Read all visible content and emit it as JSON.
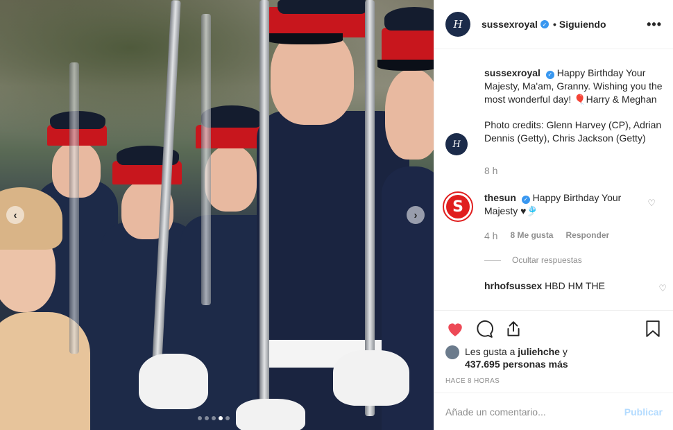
{
  "post": {
    "photo": {
      "carousel_dots": 5,
      "active_dot": 3
    },
    "header": {
      "avatar_monogram": "H",
      "username": "sussexroyal",
      "verified": true,
      "separator": "•",
      "follow_label": "Siguiendo",
      "more_icon": "more-horizontal-icon"
    },
    "caption": {
      "username": "sussexroyal",
      "text_1": "Happy Birthday Your Majesty, Ma'am, Granny. Wishing you the most wonderful day! 🎈Harry & Meghan",
      "text_2": "Photo credits: Glenn Harvey (CP), Adrian Dennis (Getty), Chris Jackson (Getty)",
      "time": "8 h"
    },
    "comments": [
      {
        "avatar_letter": "S",
        "username": "thesun",
        "verified": true,
        "text": "Happy Birthday Your Majesty ♥🎐",
        "time": "4 h",
        "likes": "8 Me gusta",
        "reply_label": "Responder",
        "hide_replies_label": "Ocultar respuestas"
      },
      {
        "username": "hrhofsussex",
        "text": "HBD HM THE"
      }
    ],
    "actions": {
      "like_icon": "heart-filled-icon",
      "comment_icon": "comment-icon",
      "share_icon": "share-icon",
      "save_icon": "bookmark-icon",
      "like_color": "#ed4956"
    },
    "likes": {
      "prefix": "Les gusta a",
      "user": "juliehche",
      "joiner": "y",
      "count": "437.695 personas más"
    },
    "timestamp": "HACE 8 HORAS",
    "add_comment": {
      "placeholder": "Añade un comentario...",
      "publish_label": "Publicar"
    }
  }
}
